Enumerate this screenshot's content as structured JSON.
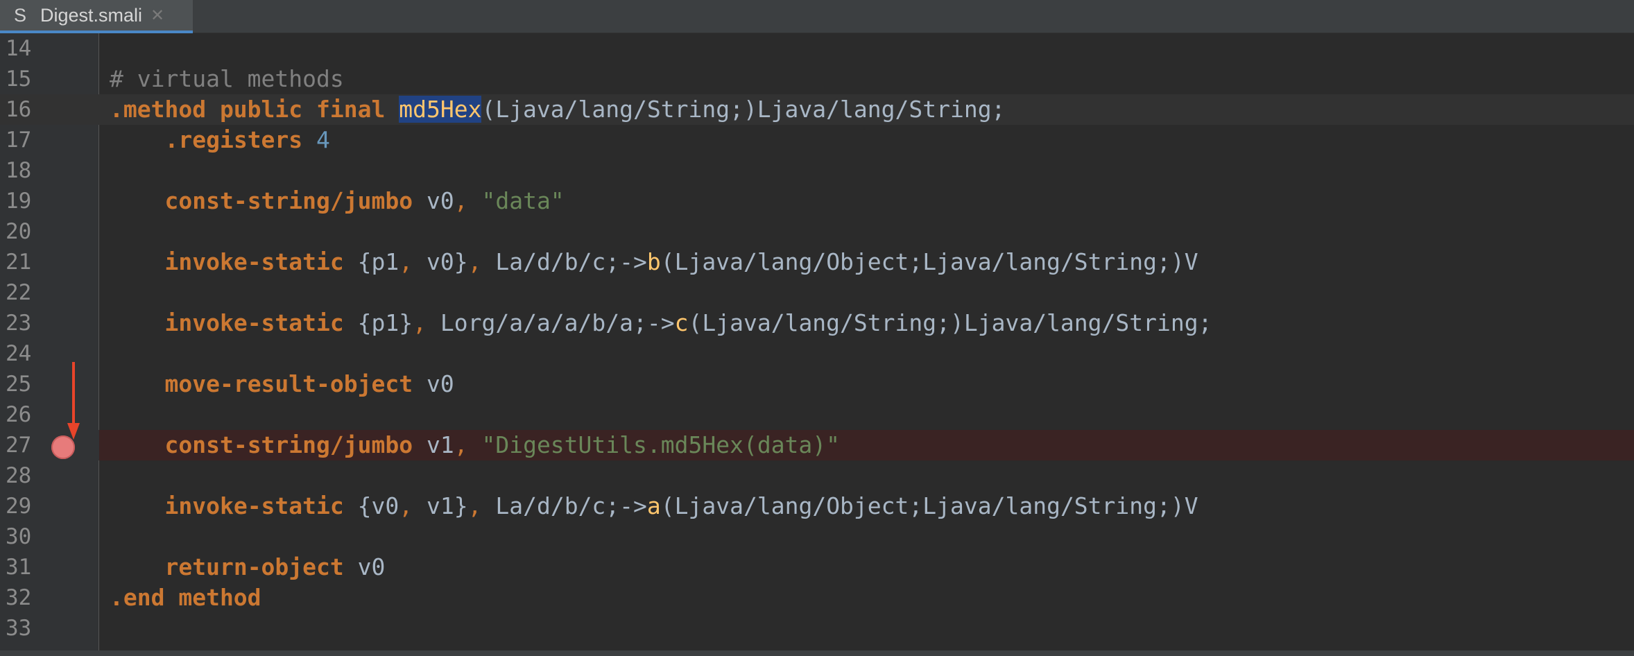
{
  "tab": {
    "icon_letter": "S",
    "label": "Digest.smali",
    "close_glyph": "✕"
  },
  "colors": {
    "keyword": "#cc7832",
    "string": "#6a8759",
    "number": "#6897bb",
    "comment": "#808080",
    "function": "#ffc66d",
    "default": "#a9b7c6",
    "breakpoint": "#e77b7b",
    "arrow": "#e8442a"
  },
  "breakpoint_line": "27",
  "annotation": "arrow-down-icon",
  "lines": [
    {
      "num": "14",
      "segments": []
    },
    {
      "num": "15",
      "segments": [
        {
          "text": "# virtual methods",
          "cls": "cmt"
        }
      ]
    },
    {
      "num": "16",
      "segments": [
        {
          "text": ".method public final ",
          "cls": "kw"
        },
        {
          "text": "md5Hex",
          "cls": "fn hl"
        },
        {
          "text": "(Ljava/lang/String;)Ljava/lang/String;",
          "cls": ""
        }
      ]
    },
    {
      "num": "17",
      "segments": [
        {
          "text": "    ",
          "cls": ""
        },
        {
          "text": ".registers ",
          "cls": "kw"
        },
        {
          "text": "4",
          "cls": "num"
        }
      ]
    },
    {
      "num": "18",
      "segments": []
    },
    {
      "num": "19",
      "segments": [
        {
          "text": "    ",
          "cls": ""
        },
        {
          "text": "const-string/jumbo",
          "cls": "kw"
        },
        {
          "text": " v0",
          "cls": ""
        },
        {
          "text": ", ",
          "cls": "op"
        },
        {
          "text": "\"data\"",
          "cls": "str"
        }
      ]
    },
    {
      "num": "20",
      "segments": []
    },
    {
      "num": "21",
      "segments": [
        {
          "text": "    ",
          "cls": ""
        },
        {
          "text": "invoke-static",
          "cls": "kw"
        },
        {
          "text": " {p1",
          "cls": ""
        },
        {
          "text": ", ",
          "cls": "op"
        },
        {
          "text": "v0}",
          "cls": ""
        },
        {
          "text": ", ",
          "cls": "op"
        },
        {
          "text": "La/d/b/c;->",
          "cls": ""
        },
        {
          "text": "b",
          "cls": "fn"
        },
        {
          "text": "(Ljava/lang/Object;Ljava/lang/String;)V",
          "cls": ""
        }
      ]
    },
    {
      "num": "22",
      "segments": []
    },
    {
      "num": "23",
      "segments": [
        {
          "text": "    ",
          "cls": ""
        },
        {
          "text": "invoke-static",
          "cls": "kw"
        },
        {
          "text": " {p1}",
          "cls": ""
        },
        {
          "text": ", ",
          "cls": "op"
        },
        {
          "text": "Lorg/a/a/a/b/a;->",
          "cls": ""
        },
        {
          "text": "c",
          "cls": "fn"
        },
        {
          "text": "(Ljava/lang/String;)Ljava/lang/String;",
          "cls": ""
        }
      ]
    },
    {
      "num": "24",
      "segments": []
    },
    {
      "num": "25",
      "segments": [
        {
          "text": "    ",
          "cls": ""
        },
        {
          "text": "move-result-object",
          "cls": "kw"
        },
        {
          "text": " v0",
          "cls": ""
        }
      ]
    },
    {
      "num": "26",
      "segments": []
    },
    {
      "num": "27",
      "segments": [
        {
          "text": "    ",
          "cls": ""
        },
        {
          "text": "const-string/jumbo",
          "cls": "kw"
        },
        {
          "text": " v1",
          "cls": ""
        },
        {
          "text": ", ",
          "cls": "op"
        },
        {
          "text": "\"DigestUtils.md5Hex(data)\"",
          "cls": "str"
        }
      ]
    },
    {
      "num": "28",
      "segments": []
    },
    {
      "num": "29",
      "segments": [
        {
          "text": "    ",
          "cls": ""
        },
        {
          "text": "invoke-static",
          "cls": "kw"
        },
        {
          "text": " {v0",
          "cls": ""
        },
        {
          "text": ", ",
          "cls": "op"
        },
        {
          "text": "v1}",
          "cls": ""
        },
        {
          "text": ", ",
          "cls": "op"
        },
        {
          "text": "La/d/b/c;->",
          "cls": ""
        },
        {
          "text": "a",
          "cls": "fn"
        },
        {
          "text": "(Ljava/lang/Object;Ljava/lang/String;)V",
          "cls": ""
        }
      ]
    },
    {
      "num": "30",
      "segments": []
    },
    {
      "num": "31",
      "segments": [
        {
          "text": "    ",
          "cls": ""
        },
        {
          "text": "return-object",
          "cls": "kw"
        },
        {
          "text": " v0",
          "cls": ""
        }
      ]
    },
    {
      "num": "32",
      "segments": [
        {
          "text": ".end method",
          "cls": "kw"
        }
      ]
    },
    {
      "num": "33",
      "segments": []
    }
  ]
}
